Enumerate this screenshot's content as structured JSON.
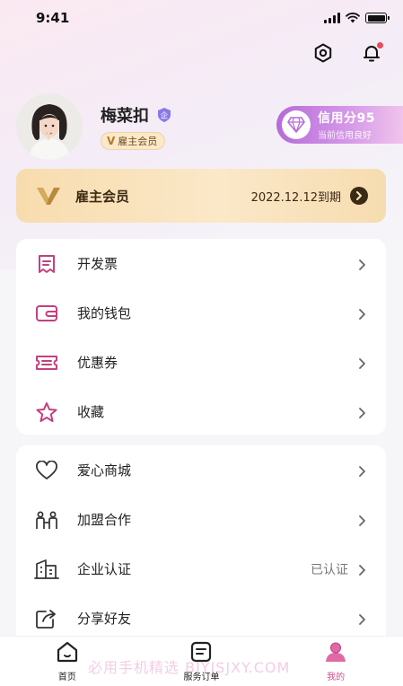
{
  "status_bar": {
    "time": "9:41"
  },
  "profile": {
    "name": "梅菜扣",
    "enterprise_badge": "企",
    "member_tag_v": "V",
    "member_tag": "雇主会员"
  },
  "credit": {
    "score_label": "信用分95",
    "desc": "当前信用良好"
  },
  "vip_card": {
    "title": "雇主会员",
    "expire": "2022.12.12到期"
  },
  "menu_group_1": [
    {
      "label": "开发票",
      "icon": "invoice-icon"
    },
    {
      "label": "我的钱包",
      "icon": "wallet-icon"
    },
    {
      "label": "优惠券",
      "icon": "coupon-icon"
    },
    {
      "label": "收藏",
      "icon": "star-icon"
    }
  ],
  "menu_group_2": [
    {
      "label": "爱心商城",
      "icon": "heart-icon",
      "value": ""
    },
    {
      "label": "加盟合作",
      "icon": "partner-icon",
      "value": ""
    },
    {
      "label": "企业认证",
      "icon": "building-icon",
      "value": "已认证"
    },
    {
      "label": "分享好友",
      "icon": "share-icon",
      "value": ""
    }
  ],
  "tabbar": {
    "items": [
      {
        "label": "首页",
        "icon": "home-icon"
      },
      {
        "label": "服务订单",
        "icon": "order-icon"
      },
      {
        "label": "我的",
        "icon": "profile-icon"
      }
    ],
    "active_index": 2
  },
  "watermark": "必用手机精选 BIYJSJXY.COM",
  "colors": {
    "accent_pink": "#d14f8e",
    "credit_purple": "#b56bd9",
    "vip_gold": "#f7dcae",
    "notice_red": "#f0475b"
  }
}
